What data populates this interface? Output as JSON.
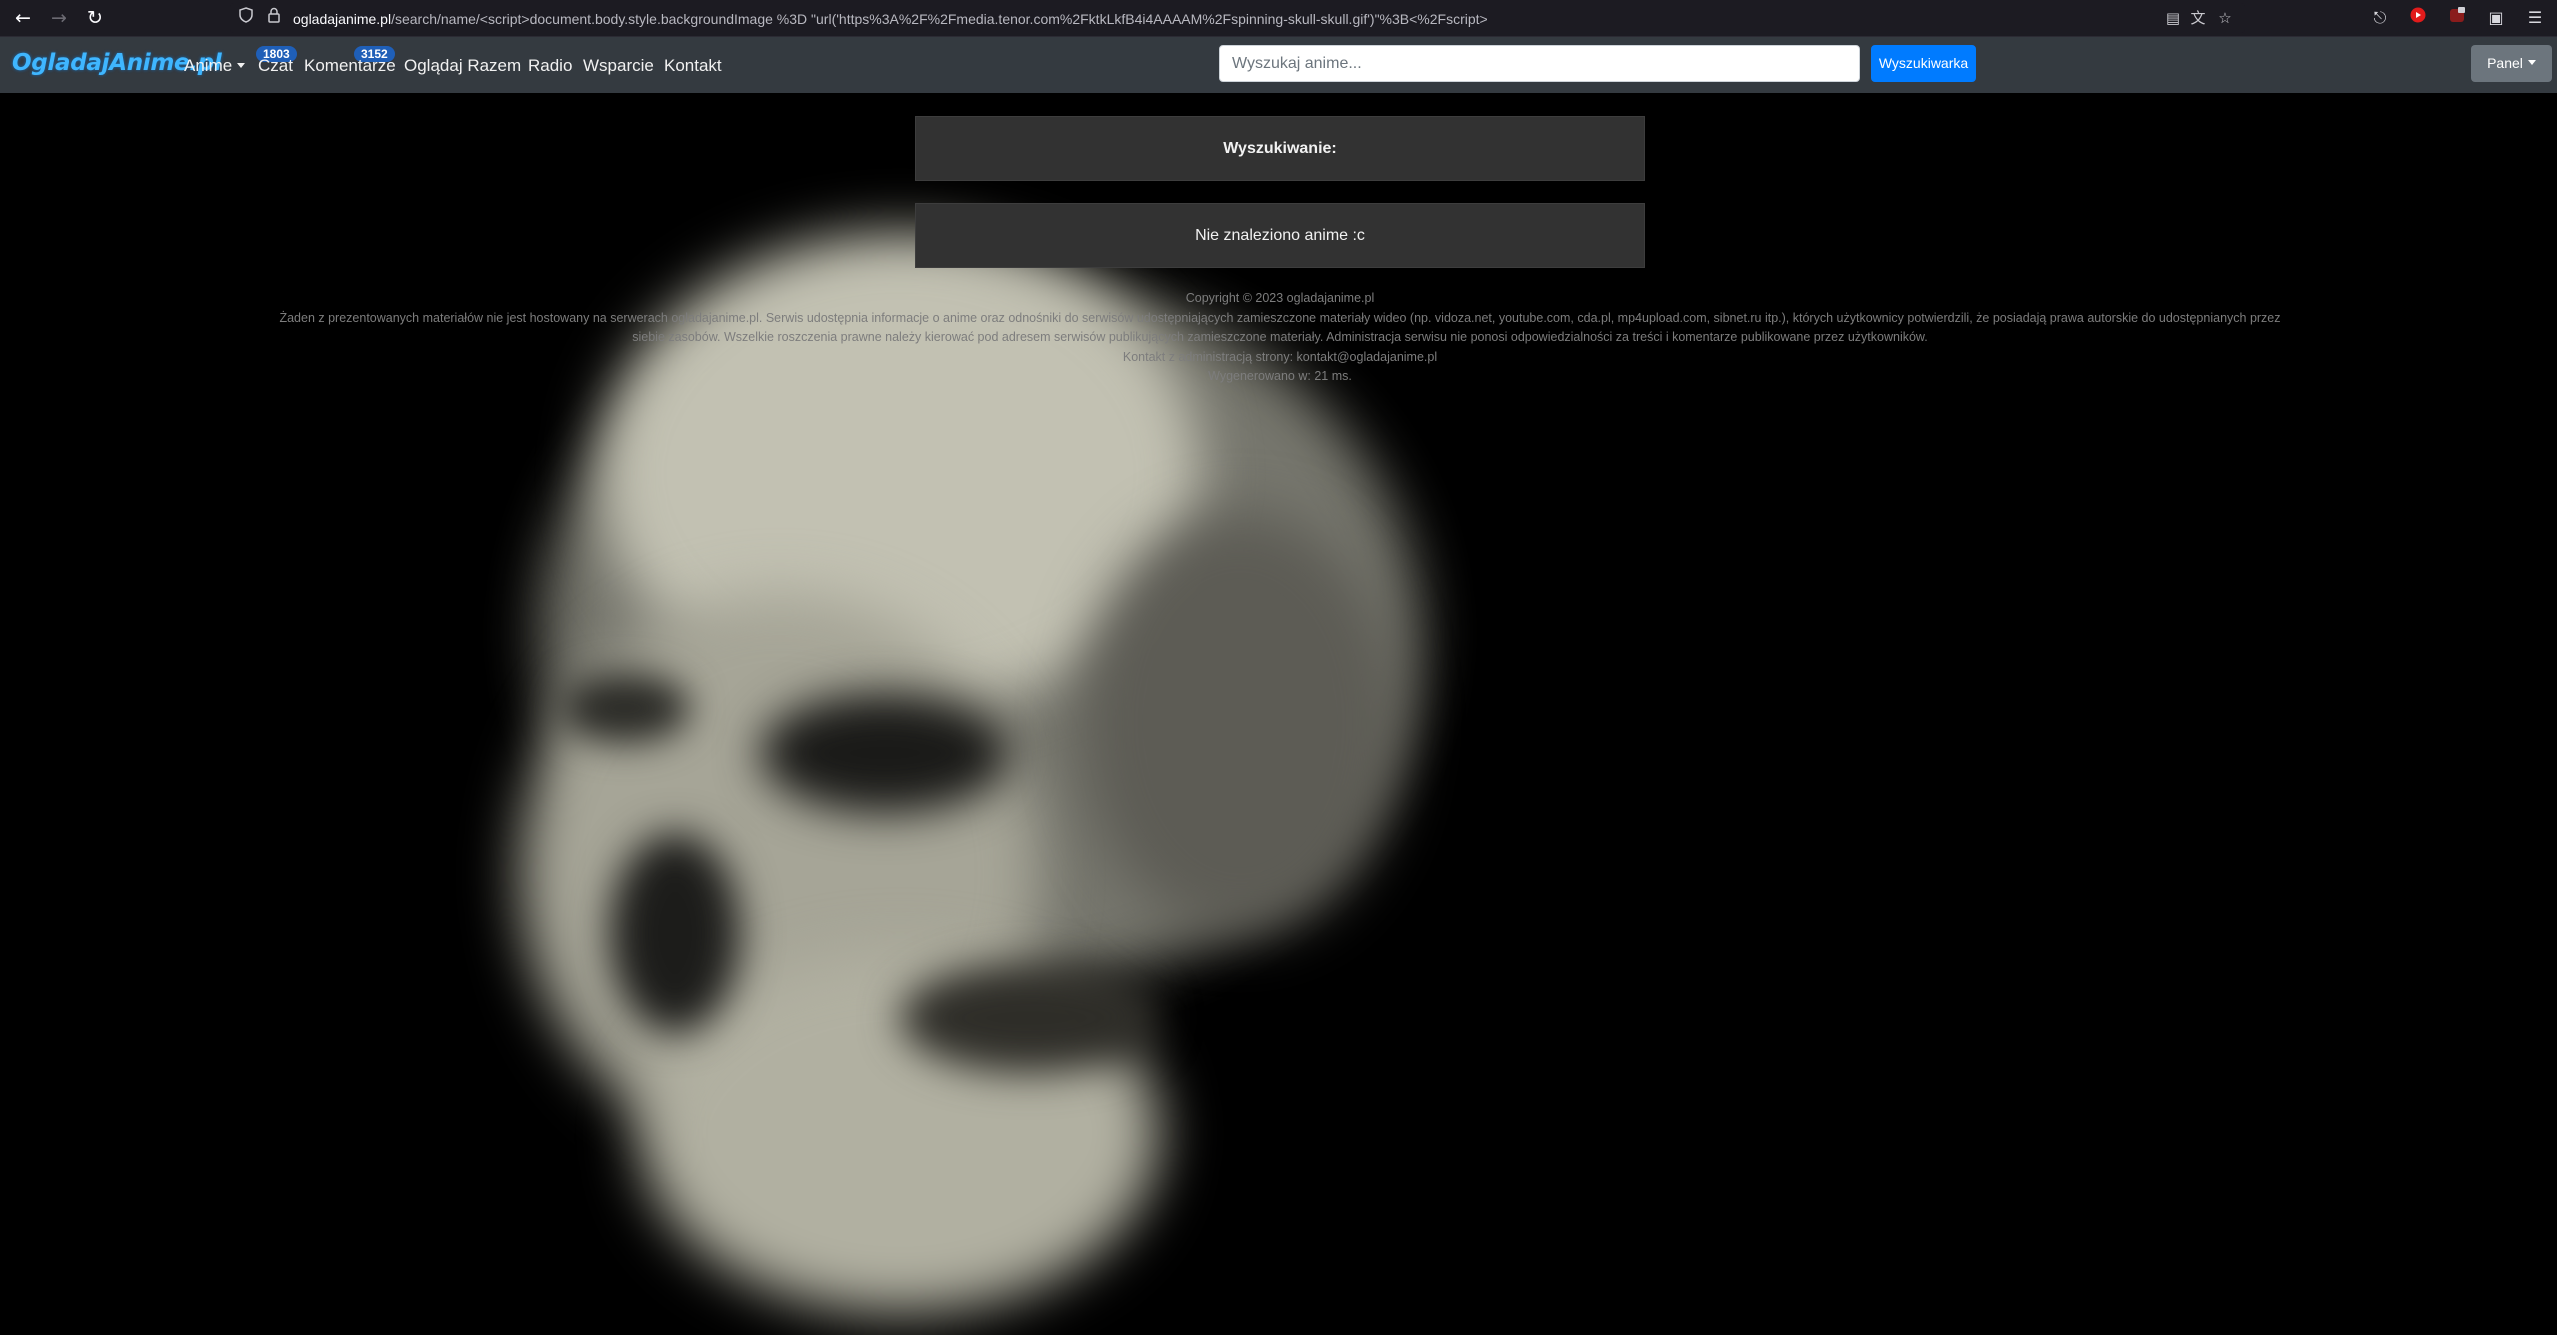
{
  "browser": {
    "url_domain": "ogladajanime.pl",
    "url_path": "/search/name/<script>document.body.style.backgroundImage %3D \"url('https%3A%2F%2Fmedia.tenor.com%2FktkLkfB4i4AAAAM%2Fspinning-skull-skull.gif')\"%3B<%2Fscript>",
    "icons": [
      "back-arrow-icon",
      "forward-arrow-icon",
      "reload-icon",
      "shield-icon",
      "lock-icon",
      "reader-view-icon",
      "translate-icon",
      "bookmark-star-icon",
      "extensions-icon",
      "youtube-icon",
      "addon-icon",
      "picture-in-picture-icon",
      "menu-icon"
    ]
  },
  "navbar": {
    "brand": "OgladajAnime.pl",
    "links": {
      "anime": "Anime",
      "czat": "Czat",
      "komentarze": "Komentarze",
      "ogladaj_razem": "Oglądaj Razem",
      "radio": "Radio",
      "wsparcie": "Wsparcie",
      "kontakt": "Kontakt"
    },
    "badges": {
      "czat": "1803",
      "komentarze": "3152"
    },
    "search_placeholder": "Wyszukaj anime...",
    "search_button": "Wyszukiwarka",
    "panel_button": "Panel",
    "colors": {
      "bg": "#343a40",
      "brand": "#3fb6ff",
      "primary": "#007bff",
      "secondary": "#6c757d"
    }
  },
  "main": {
    "search_heading": "Wyszukiwanie:",
    "no_results": "Nie znaleziono anime :c"
  },
  "footer": {
    "copyright": "Copyright © 2023 ogladajanime.pl",
    "disclaimer_line1": "Żaden z prezentowanych materiałów nie jest hostowany na serwerach ogladajanime.pl. Serwis udostępnia informacje o anime oraz odnośniki do serwisów udostępniających zamieszczone materiały wideo (np. vidoza.net, youtube.com, cda.pl, mp4upload.com, sibnet.ru itp.), których użytkownicy potwierdzili, że posiadają prawa autorskie do udostępnianych przez",
    "disclaimer_line2": "siebie zasobów. Wszelkie roszczenia prawne należy kierować pod adresem serwisów publikujących zamieszczone materiały. Administracja serwisu nie ponosi odpowiedzialności za treści i komentarze publikowane przez użytkowników.",
    "contact": "Kontakt z administracją strony: kontakt@ogladajanime.pl",
    "generated": "Wygenerowano w: 21 ms."
  }
}
